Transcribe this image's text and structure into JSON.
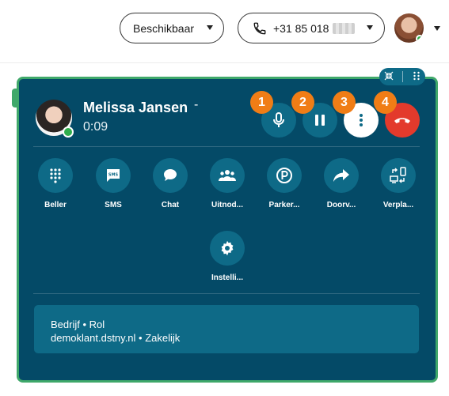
{
  "header": {
    "status_label": "Beschikbaar",
    "phone_number": "+31 85 018",
    "user_avatar": "user-avatar"
  },
  "call": {
    "caller_name": "Melissa Jansen",
    "caller_name_suffix": "-",
    "timer": "0:09",
    "controls": [
      {
        "badge": "1",
        "icon": "microphone-icon"
      },
      {
        "badge": "2",
        "icon": "pause-icon"
      },
      {
        "badge": "3",
        "icon": "more-vertical-icon"
      },
      {
        "badge": "4",
        "icon": "hang-up-icon"
      }
    ]
  },
  "actions": [
    {
      "label": "Beller",
      "icon": "dialpad-icon"
    },
    {
      "label": "SMS",
      "icon": "sms-icon"
    },
    {
      "label": "Chat",
      "icon": "chat-icon"
    },
    {
      "label": "Uitnod...",
      "icon": "people-icon"
    },
    {
      "label": "Parker...",
      "icon": "park-icon"
    },
    {
      "label": "Doorv...",
      "icon": "forward-icon"
    },
    {
      "label": "Verpla...",
      "icon": "transfer-device-icon"
    },
    {
      "label": "Instelli...",
      "icon": "settings-icon"
    }
  ],
  "info": {
    "line1": "Bedrijf • Rol",
    "line2": "demoklant.dstny.nl • Zakelijk"
  },
  "colors": {
    "panel": "#044a67",
    "panel_border": "#3fa86a",
    "button": "#0e6a87",
    "badge": "#f07d16",
    "hangup": "#e33a2c",
    "online": "#2fae4c"
  }
}
